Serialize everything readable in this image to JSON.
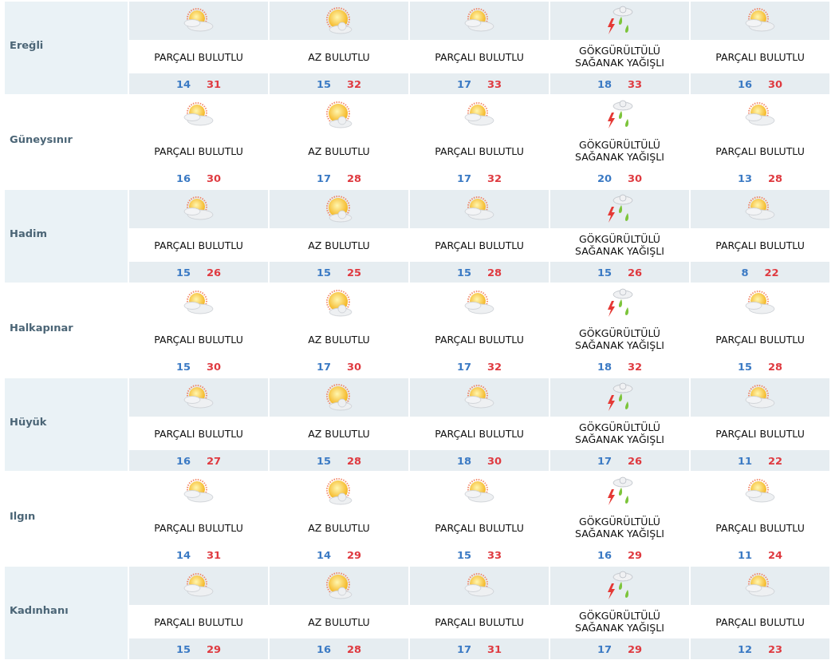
{
  "rows": [
    {
      "city": "Ereğli",
      "days": [
        {
          "kind": "partly",
          "condition": "PARÇALI BULUTLU",
          "low": "14",
          "high": "31"
        },
        {
          "kind": "mostly_sunny",
          "condition": "AZ BULUTLU",
          "low": "15",
          "high": "32"
        },
        {
          "kind": "partly",
          "condition": "PARÇALI BULUTLU",
          "low": "17",
          "high": "33"
        },
        {
          "kind": "thunder",
          "condition": "GÖKGÜRÜLTÜLÜ SAĞANAK YAĞIŞLI",
          "low": "18",
          "high": "33"
        },
        {
          "kind": "partly",
          "condition": "PARÇALI BULUTLU",
          "low": "16",
          "high": "30"
        }
      ]
    },
    {
      "city": "Güneysınır",
      "days": [
        {
          "kind": "partly",
          "condition": "PARÇALI BULUTLU",
          "low": "16",
          "high": "30"
        },
        {
          "kind": "mostly_sunny",
          "condition": "AZ BULUTLU",
          "low": "17",
          "high": "28"
        },
        {
          "kind": "partly",
          "condition": "PARÇALI BULUTLU",
          "low": "17",
          "high": "32"
        },
        {
          "kind": "thunder",
          "condition": "GÖKGÜRÜLTÜLÜ SAĞANAK YAĞIŞLI",
          "low": "20",
          "high": "30"
        },
        {
          "kind": "partly",
          "condition": "PARÇALI BULUTLU",
          "low": "13",
          "high": "28"
        }
      ]
    },
    {
      "city": "Hadim",
      "days": [
        {
          "kind": "partly",
          "condition": "PARÇALI BULUTLU",
          "low": "15",
          "high": "26"
        },
        {
          "kind": "mostly_sunny",
          "condition": "AZ BULUTLU",
          "low": "15",
          "high": "25"
        },
        {
          "kind": "partly",
          "condition": "PARÇALI BULUTLU",
          "low": "15",
          "high": "28"
        },
        {
          "kind": "thunder",
          "condition": "GÖKGÜRÜLTÜLÜ SAĞANAK YAĞIŞLI",
          "low": "15",
          "high": "26"
        },
        {
          "kind": "partly",
          "condition": "PARÇALI BULUTLU",
          "low": "8",
          "high": "22"
        }
      ]
    },
    {
      "city": "Halkapınar",
      "days": [
        {
          "kind": "partly",
          "condition": "PARÇALI BULUTLU",
          "low": "15",
          "high": "30"
        },
        {
          "kind": "mostly_sunny",
          "condition": "AZ BULUTLU",
          "low": "17",
          "high": "30"
        },
        {
          "kind": "partly",
          "condition": "PARÇALI BULUTLU",
          "low": "17",
          "high": "32"
        },
        {
          "kind": "thunder",
          "condition": "GÖKGÜRÜLTÜLÜ SAĞANAK YAĞIŞLI",
          "low": "18",
          "high": "32"
        },
        {
          "kind": "partly",
          "condition": "PARÇALI BULUTLU",
          "low": "15",
          "high": "28"
        }
      ]
    },
    {
      "city": "Hüyük",
      "days": [
        {
          "kind": "partly",
          "condition": "PARÇALI BULUTLU",
          "low": "16",
          "high": "27"
        },
        {
          "kind": "mostly_sunny",
          "condition": "AZ BULUTLU",
          "low": "15",
          "high": "28"
        },
        {
          "kind": "partly",
          "condition": "PARÇALI BULUTLU",
          "low": "18",
          "high": "30"
        },
        {
          "kind": "thunder",
          "condition": "GÖKGÜRÜLTÜLÜ SAĞANAK YAĞIŞLI",
          "low": "17",
          "high": "26"
        },
        {
          "kind": "partly",
          "condition": "PARÇALI BULUTLU",
          "low": "11",
          "high": "22"
        }
      ]
    },
    {
      "city": "Ilgın",
      "days": [
        {
          "kind": "partly",
          "condition": "PARÇALI BULUTLU",
          "low": "14",
          "high": "31"
        },
        {
          "kind": "mostly_sunny",
          "condition": "AZ BULUTLU",
          "low": "14",
          "high": "29"
        },
        {
          "kind": "partly",
          "condition": "PARÇALI BULUTLU",
          "low": "15",
          "high": "33"
        },
        {
          "kind": "thunder",
          "condition": "GÖKGÜRÜLTÜLÜ SAĞANAK YAĞIŞLI",
          "low": "16",
          "high": "29"
        },
        {
          "kind": "partly",
          "condition": "PARÇALI BULUTLU",
          "low": "11",
          "high": "24"
        }
      ]
    },
    {
      "city": "Kadınhanı",
      "days": [
        {
          "kind": "partly",
          "condition": "PARÇALI BULUTLU",
          "low": "15",
          "high": "29"
        },
        {
          "kind": "mostly_sunny",
          "condition": "AZ BULUTLU",
          "low": "16",
          "high": "28"
        },
        {
          "kind": "partly",
          "condition": "PARÇALI BULUTLU",
          "low": "17",
          "high": "31"
        },
        {
          "kind": "thunder",
          "condition": "GÖKGÜRÜLTÜLÜ SAĞANAK YAĞIŞLI",
          "low": "17",
          "high": "29"
        },
        {
          "kind": "partly",
          "condition": "PARÇALI BULUTLU",
          "low": "12",
          "high": "23"
        }
      ]
    }
  ]
}
